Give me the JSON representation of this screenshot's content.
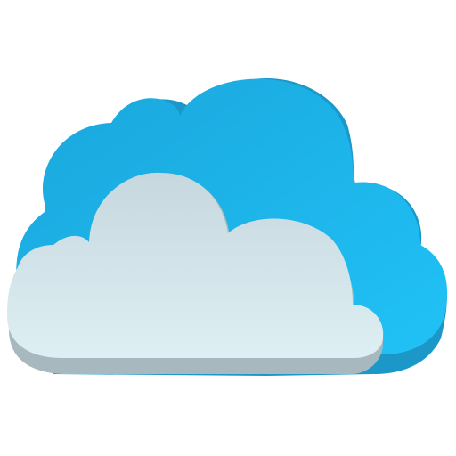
{
  "icon": {
    "name": "cloud-icon",
    "colors": {
      "back_cloud_top": "#1aa6db",
      "back_cloud_bottom": "#20c2f7",
      "back_cloud_shadow": "#1b97c8",
      "front_cloud_top": "#c6d8de",
      "front_cloud_bottom": "#deeff4",
      "front_cloud_shadow": "#a7b9bf"
    }
  }
}
